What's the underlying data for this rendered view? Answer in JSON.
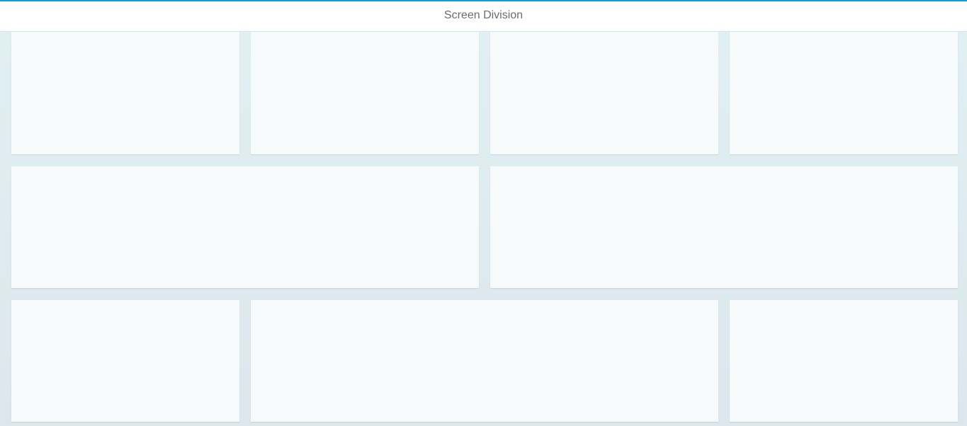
{
  "header": {
    "title": "Screen Division",
    "accent_color": "#0a9be2"
  },
  "layout": {
    "rows": [
      {
        "tiles": [
          {
            "span": 1
          },
          {
            "span": 1
          },
          {
            "span": 1
          },
          {
            "span": 1
          }
        ]
      },
      {
        "tiles": [
          {
            "span": 2
          },
          {
            "span": 2
          }
        ]
      },
      {
        "tiles": [
          {
            "span": 1
          },
          {
            "span": 2
          },
          {
            "span": 1
          }
        ]
      }
    ]
  }
}
